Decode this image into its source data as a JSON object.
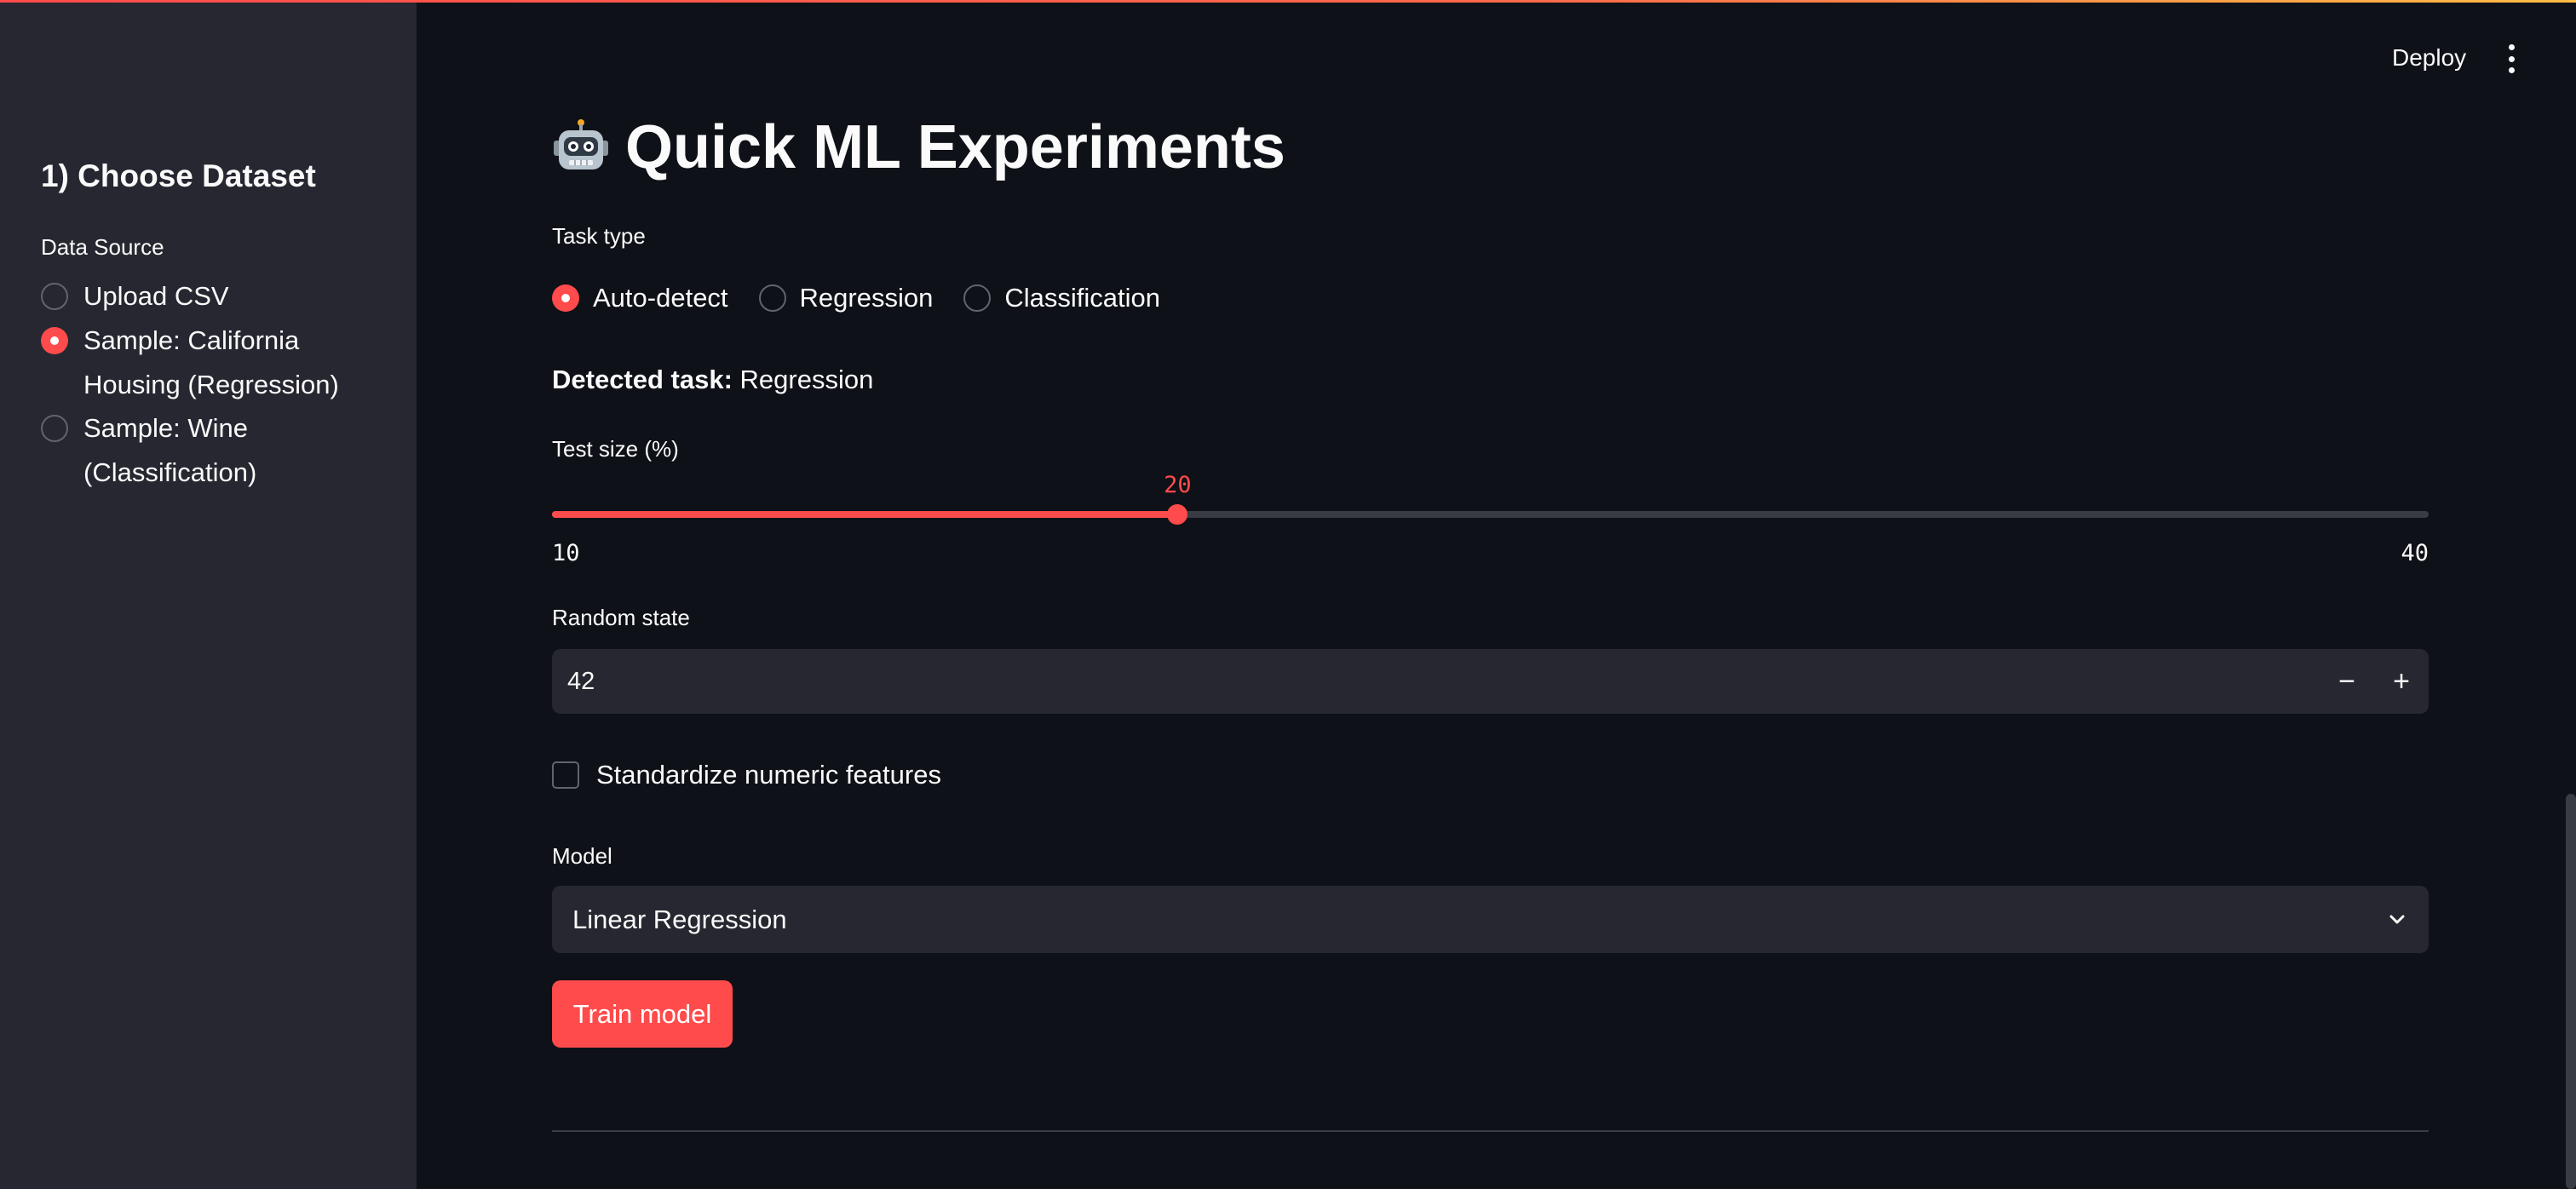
{
  "app": {
    "deploy_label": "Deploy",
    "menu_icon": "vertical-dots-icon",
    "accent_color": "#ff4b4b"
  },
  "sidebar": {
    "heading": "1) Choose Dataset",
    "data_source_label": "Data Source",
    "options": [
      {
        "label": "Upload CSV",
        "selected": false
      },
      {
        "label": "Sample: California Housing (Regression)",
        "selected": true
      },
      {
        "label": "Sample: Wine (Classification)",
        "selected": false
      }
    ]
  },
  "main": {
    "title_icon": "robot-icon",
    "title": "Quick ML Experiments",
    "task_type": {
      "label": "Task type",
      "options": [
        {
          "label": "Auto-detect",
          "selected": true
        },
        {
          "label": "Regression",
          "selected": false
        },
        {
          "label": "Classification",
          "selected": false
        }
      ]
    },
    "detected": {
      "label": "Detected task:",
      "value": "Regression"
    },
    "test_size": {
      "label": "Test size (%)",
      "value": "20",
      "min": "10",
      "max": "40"
    },
    "random_state": {
      "label": "Random state",
      "value": "42",
      "decrement": "−",
      "increment": "+"
    },
    "standardize": {
      "label": "Standardize numeric features",
      "checked": false
    },
    "model": {
      "label": "Model",
      "value": "Linear Regression",
      "icon": "chevron-down-icon"
    },
    "train_button": "Train model"
  }
}
